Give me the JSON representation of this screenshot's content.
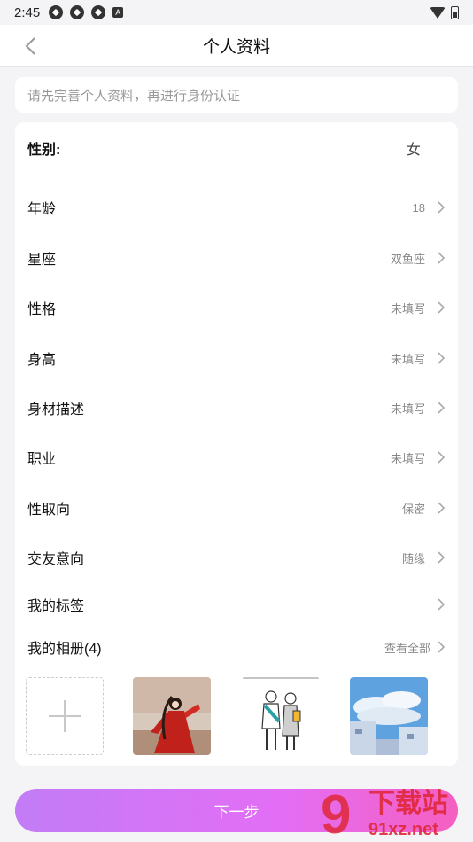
{
  "status_bar": {
    "time": "2:45",
    "icon_letter": "A"
  },
  "nav": {
    "title": "个人资料"
  },
  "notice": {
    "text": "请先完善个人资料，再进行身份认证"
  },
  "profile": {
    "gender": {
      "label": "性别:",
      "value": "女"
    },
    "rows": [
      {
        "label": "年龄",
        "value": "18"
      },
      {
        "label": "星座",
        "value": "双鱼座"
      },
      {
        "label": "性格",
        "value": "未填写"
      },
      {
        "label": "身高",
        "value": "未填写"
      },
      {
        "label": "身材描述",
        "value": "未填写"
      },
      {
        "label": "职业",
        "value": "未填写"
      },
      {
        "label": "性取向",
        "value": "保密"
      },
      {
        "label": "交友意向",
        "value": "随缘"
      },
      {
        "label": "我的标签",
        "value": ""
      }
    ],
    "album": {
      "label": "我的相册(4)",
      "view_all": "查看全部"
    }
  },
  "photos": [
    "photo-woman-red-dress",
    "photo-couple-illustration",
    "photo-anime-sky-street"
  ],
  "footer": {
    "next_label": "下一步"
  },
  "watermark": {
    "text": "下载站",
    "url": "91xz.net",
    "number": "9"
  },
  "colors": {
    "button_start": "#c27cf6",
    "button_end": "#f55fc0",
    "watermark": "#e0283a"
  }
}
